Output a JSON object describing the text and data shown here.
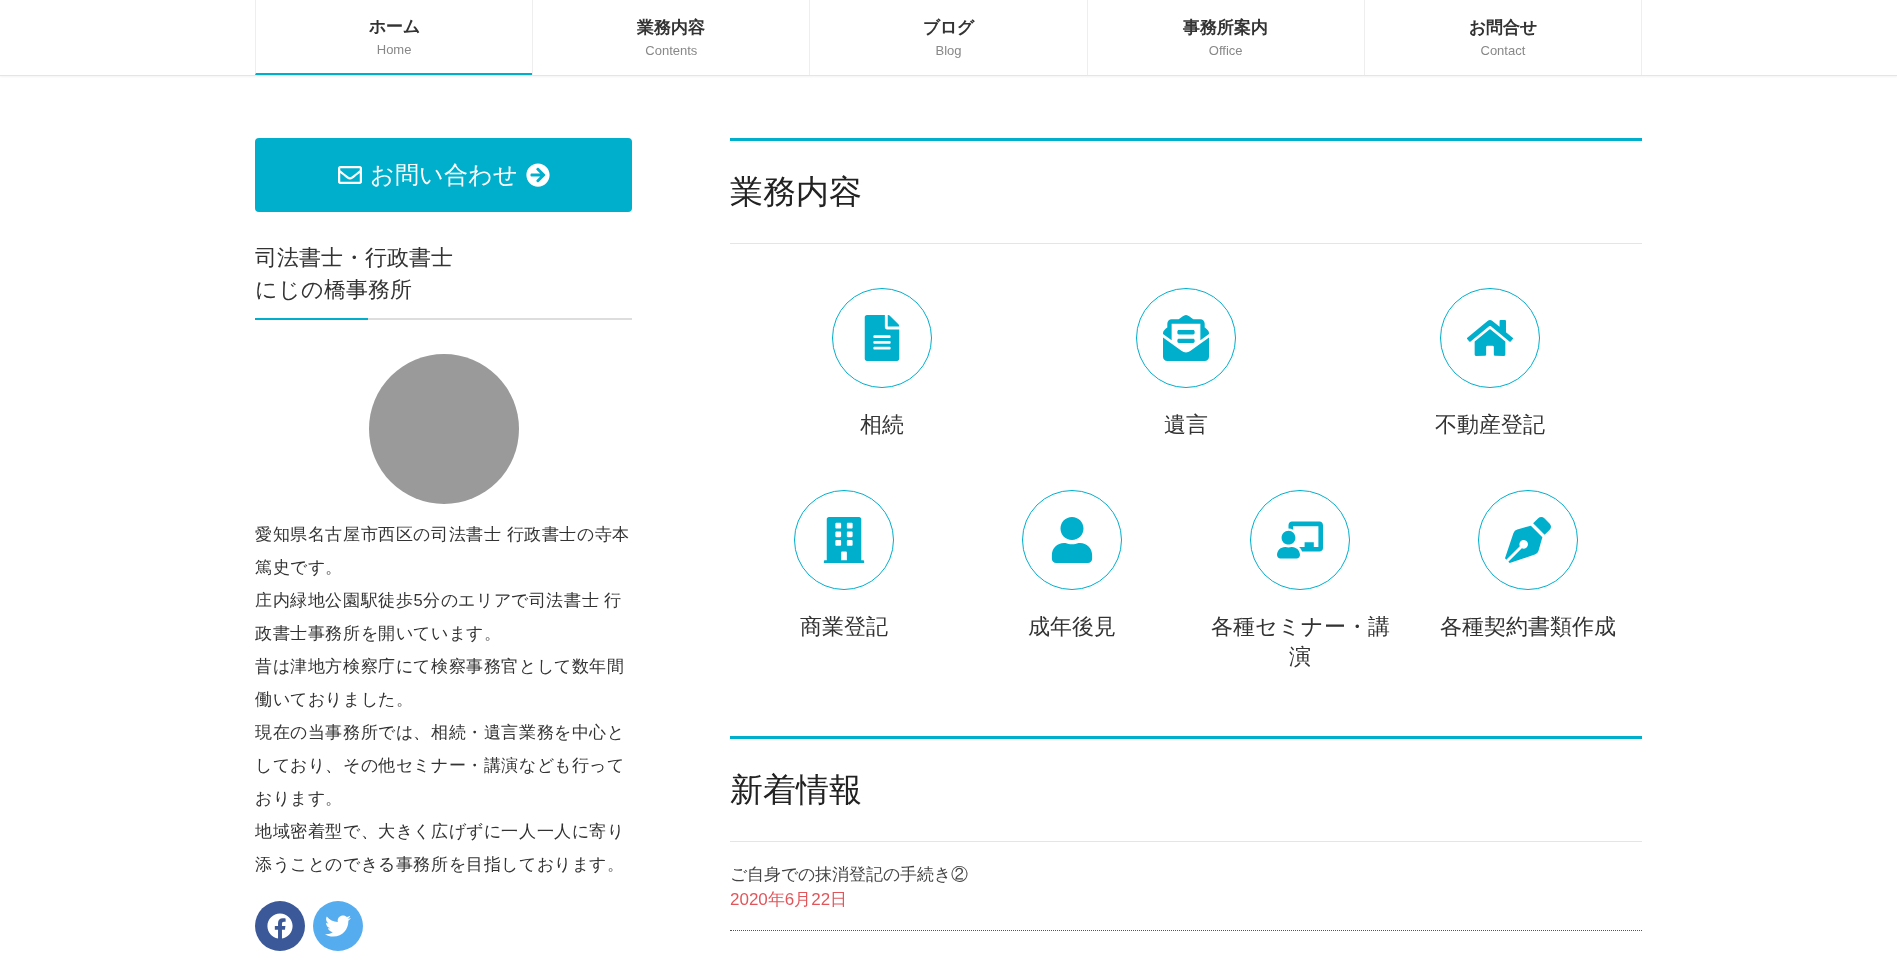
{
  "nav": [
    {
      "label": "ホーム",
      "sub": "Home",
      "selected": true
    },
    {
      "label": "業務内容",
      "sub": "Contents",
      "selected": false
    },
    {
      "label": "ブログ",
      "sub": "Blog",
      "selected": false
    },
    {
      "label": "事務所案内",
      "sub": "Office",
      "selected": false
    },
    {
      "label": "お問合せ",
      "sub": "Contact",
      "selected": false
    }
  ],
  "sidebar": {
    "contact_button": "お問い合わせ",
    "title_lines": [
      "司法書士・行政書士",
      "にじの橋事務所"
    ],
    "bio": [
      "愛知県名古屋市西区の司法書士 行政書士の寺本篤史です。",
      "庄内緑地公園駅徒歩5分のエリアで司法書士 行政書士事務所を開いています。",
      "昔は津地方検察庁にて検察事務官として数年間働いておりました。",
      "現在の当事務所では、相続・遺言業務を中心としており、その他セミナー・講演なども行っております。",
      "地域密着型で、大きく広げずに一人一人に寄り添うことのできる事務所を目指しております。"
    ]
  },
  "services": {
    "heading": "業務内容",
    "groups": [
      {
        "items": [
          {
            "label": "相続"
          },
          {
            "label": "遺言"
          },
          {
            "label": "不動産登記"
          }
        ]
      },
      {
        "items": [
          {
            "label": "商業登記"
          },
          {
            "label": "成年後見"
          },
          {
            "label": "各種セミナー・講演"
          },
          {
            "label": "各種契約書類作成"
          }
        ]
      }
    ]
  },
  "news": {
    "heading": "新着情報",
    "items": [
      {
        "title": "ご自身での抹消登記の手続き②",
        "date": "2020年6月22日"
      }
    ]
  }
}
